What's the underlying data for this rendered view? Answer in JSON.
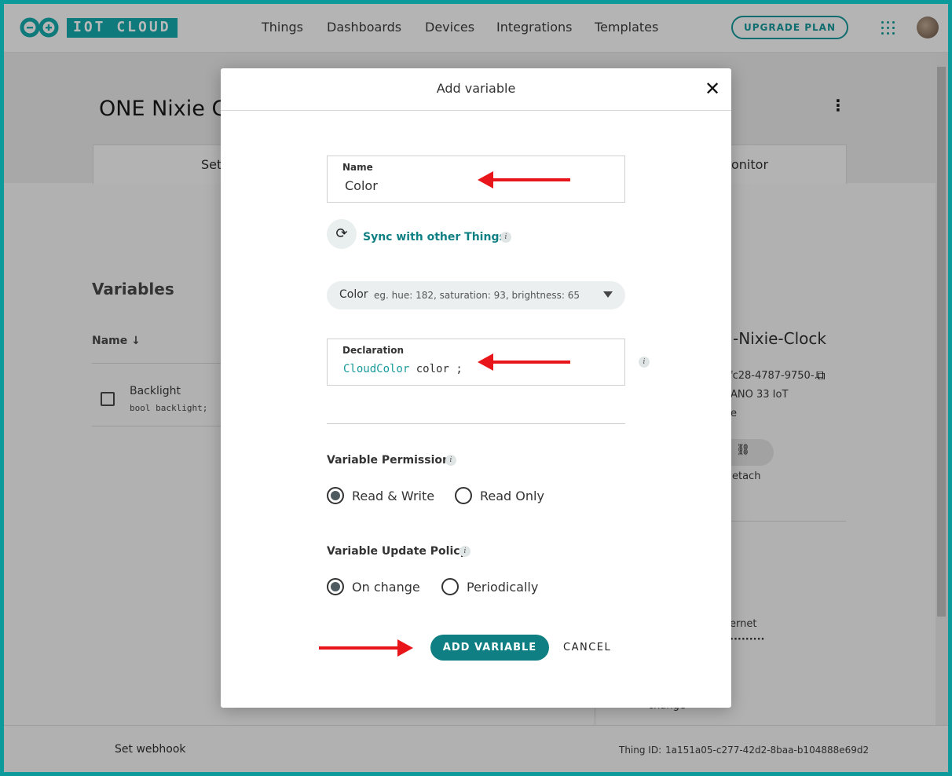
{
  "header": {
    "brand": "IOT CLOUD",
    "nav": [
      "Things",
      "Dashboards",
      "Devices",
      "Integrations",
      "Templates"
    ],
    "upgrade": "UPGRADE PLAN"
  },
  "page": {
    "title": "ONE Nixie C",
    "tab_setup": "Set",
    "tab_monitor": "onitor",
    "variables_heading": "Variables",
    "name_col": "Name",
    "variable": {
      "name": "Backlight",
      "decl": "bool backlight;"
    },
    "device": {
      "name": "-Nixie-Clock",
      "id": "fc28-4787-9750-...",
      "type": "ANO 33 IoT",
      "status": "e",
      "detach": "etach",
      "network": "ernet",
      "password": "·········",
      "policy": "change"
    },
    "footer": {
      "webhook": "Set webhook",
      "thing_id_label": "Thing ID:",
      "thing_id": "1a151a05-c277-42d2-8baa-b104888e69d2"
    }
  },
  "modal": {
    "title": "Add variable",
    "name_label": "Name",
    "name_value": "Color",
    "sync": "Sync with other Things",
    "type": "Color",
    "type_example": "eg. hue: 182, saturation: 93, brightness: 65",
    "decl_label": "Declaration",
    "decl_type": "CloudColor",
    "decl_name": "color",
    "decl_end": ";",
    "permission_label": "Variable Permission",
    "perm_options": [
      "Read & Write",
      "Read Only"
    ],
    "perm_selected": "Read & Write",
    "policy_label": "Variable Update Policy",
    "policy_options": [
      "On change",
      "Periodically"
    ],
    "policy_selected": "On change",
    "add": "ADD VARIABLE",
    "cancel": "CANCEL"
  },
  "colors": {
    "teal": "#008184",
    "arrow": "#e8161a",
    "frame": "#0c9a9a"
  }
}
